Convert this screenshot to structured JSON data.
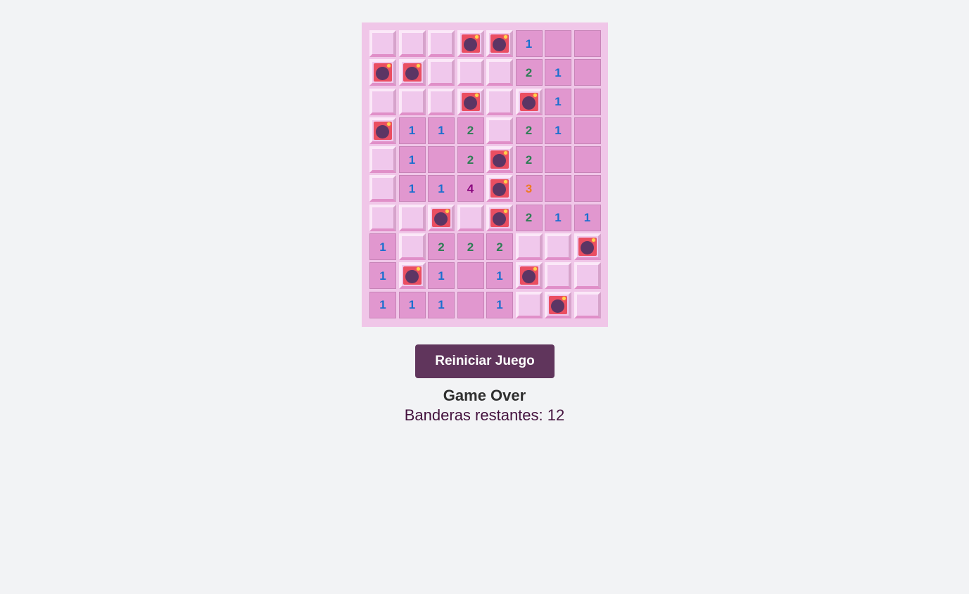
{
  "game": {
    "rows": 10,
    "cols": 8,
    "colors": {
      "1": "#1b6fcf",
      "2": "#2e7d55",
      "3": "#ef7b22",
      "4": "#8a087f"
    },
    "grid": [
      [
        "h",
        "h",
        "h",
        "b",
        "b",
        "1",
        "o",
        "o"
      ],
      [
        "b",
        "b",
        "h",
        "h",
        "h",
        "2",
        "1",
        "o"
      ],
      [
        "h",
        "h",
        "h",
        "b",
        "h",
        "b",
        "1",
        "o"
      ],
      [
        "b",
        "1",
        "1",
        "2",
        "h",
        "2",
        "1",
        "o"
      ],
      [
        "h",
        "1",
        "o",
        "2",
        "b",
        "2",
        "o",
        "o"
      ],
      [
        "h",
        "1",
        "1",
        "4",
        "b",
        "3",
        "o",
        "o"
      ],
      [
        "h",
        "h",
        "b",
        "h",
        "b",
        "2",
        "1",
        "1"
      ],
      [
        "1",
        "h",
        "2",
        "2",
        "2",
        "h",
        "h",
        "b"
      ],
      [
        "1",
        "b",
        "1",
        "o",
        "1",
        "b",
        "h",
        "h"
      ],
      [
        "1",
        "1",
        "1",
        "o",
        "1",
        "h",
        "b",
        "h"
      ]
    ]
  },
  "controls": {
    "restart_label": "Reiniciar Juego"
  },
  "status": {
    "message": "Game Over",
    "flags_text": "Banderas restantes: 12"
  }
}
